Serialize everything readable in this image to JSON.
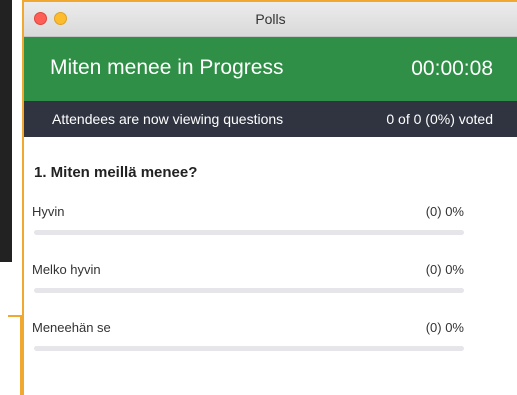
{
  "window": {
    "title": "Polls"
  },
  "poll": {
    "title": "Miten menee in Progress",
    "timer": "00:00:08",
    "status": "Attendees are now viewing questions",
    "votes": "0 of 0 (0%) voted"
  },
  "question": {
    "text": "1. Miten meillä menee?",
    "answers": [
      {
        "label": "Hyvin",
        "result": "(0) 0%",
        "fraction": 0
      },
      {
        "label": "Melko hyvin",
        "result": "(0) 0%",
        "fraction": 0
      },
      {
        "label": "Meneehän se",
        "result": "(0) 0%",
        "fraction": 0
      }
    ]
  },
  "colors": {
    "header": "#2f8f46",
    "status_bar": "#2f3440",
    "highlight": "#f0a830"
  }
}
